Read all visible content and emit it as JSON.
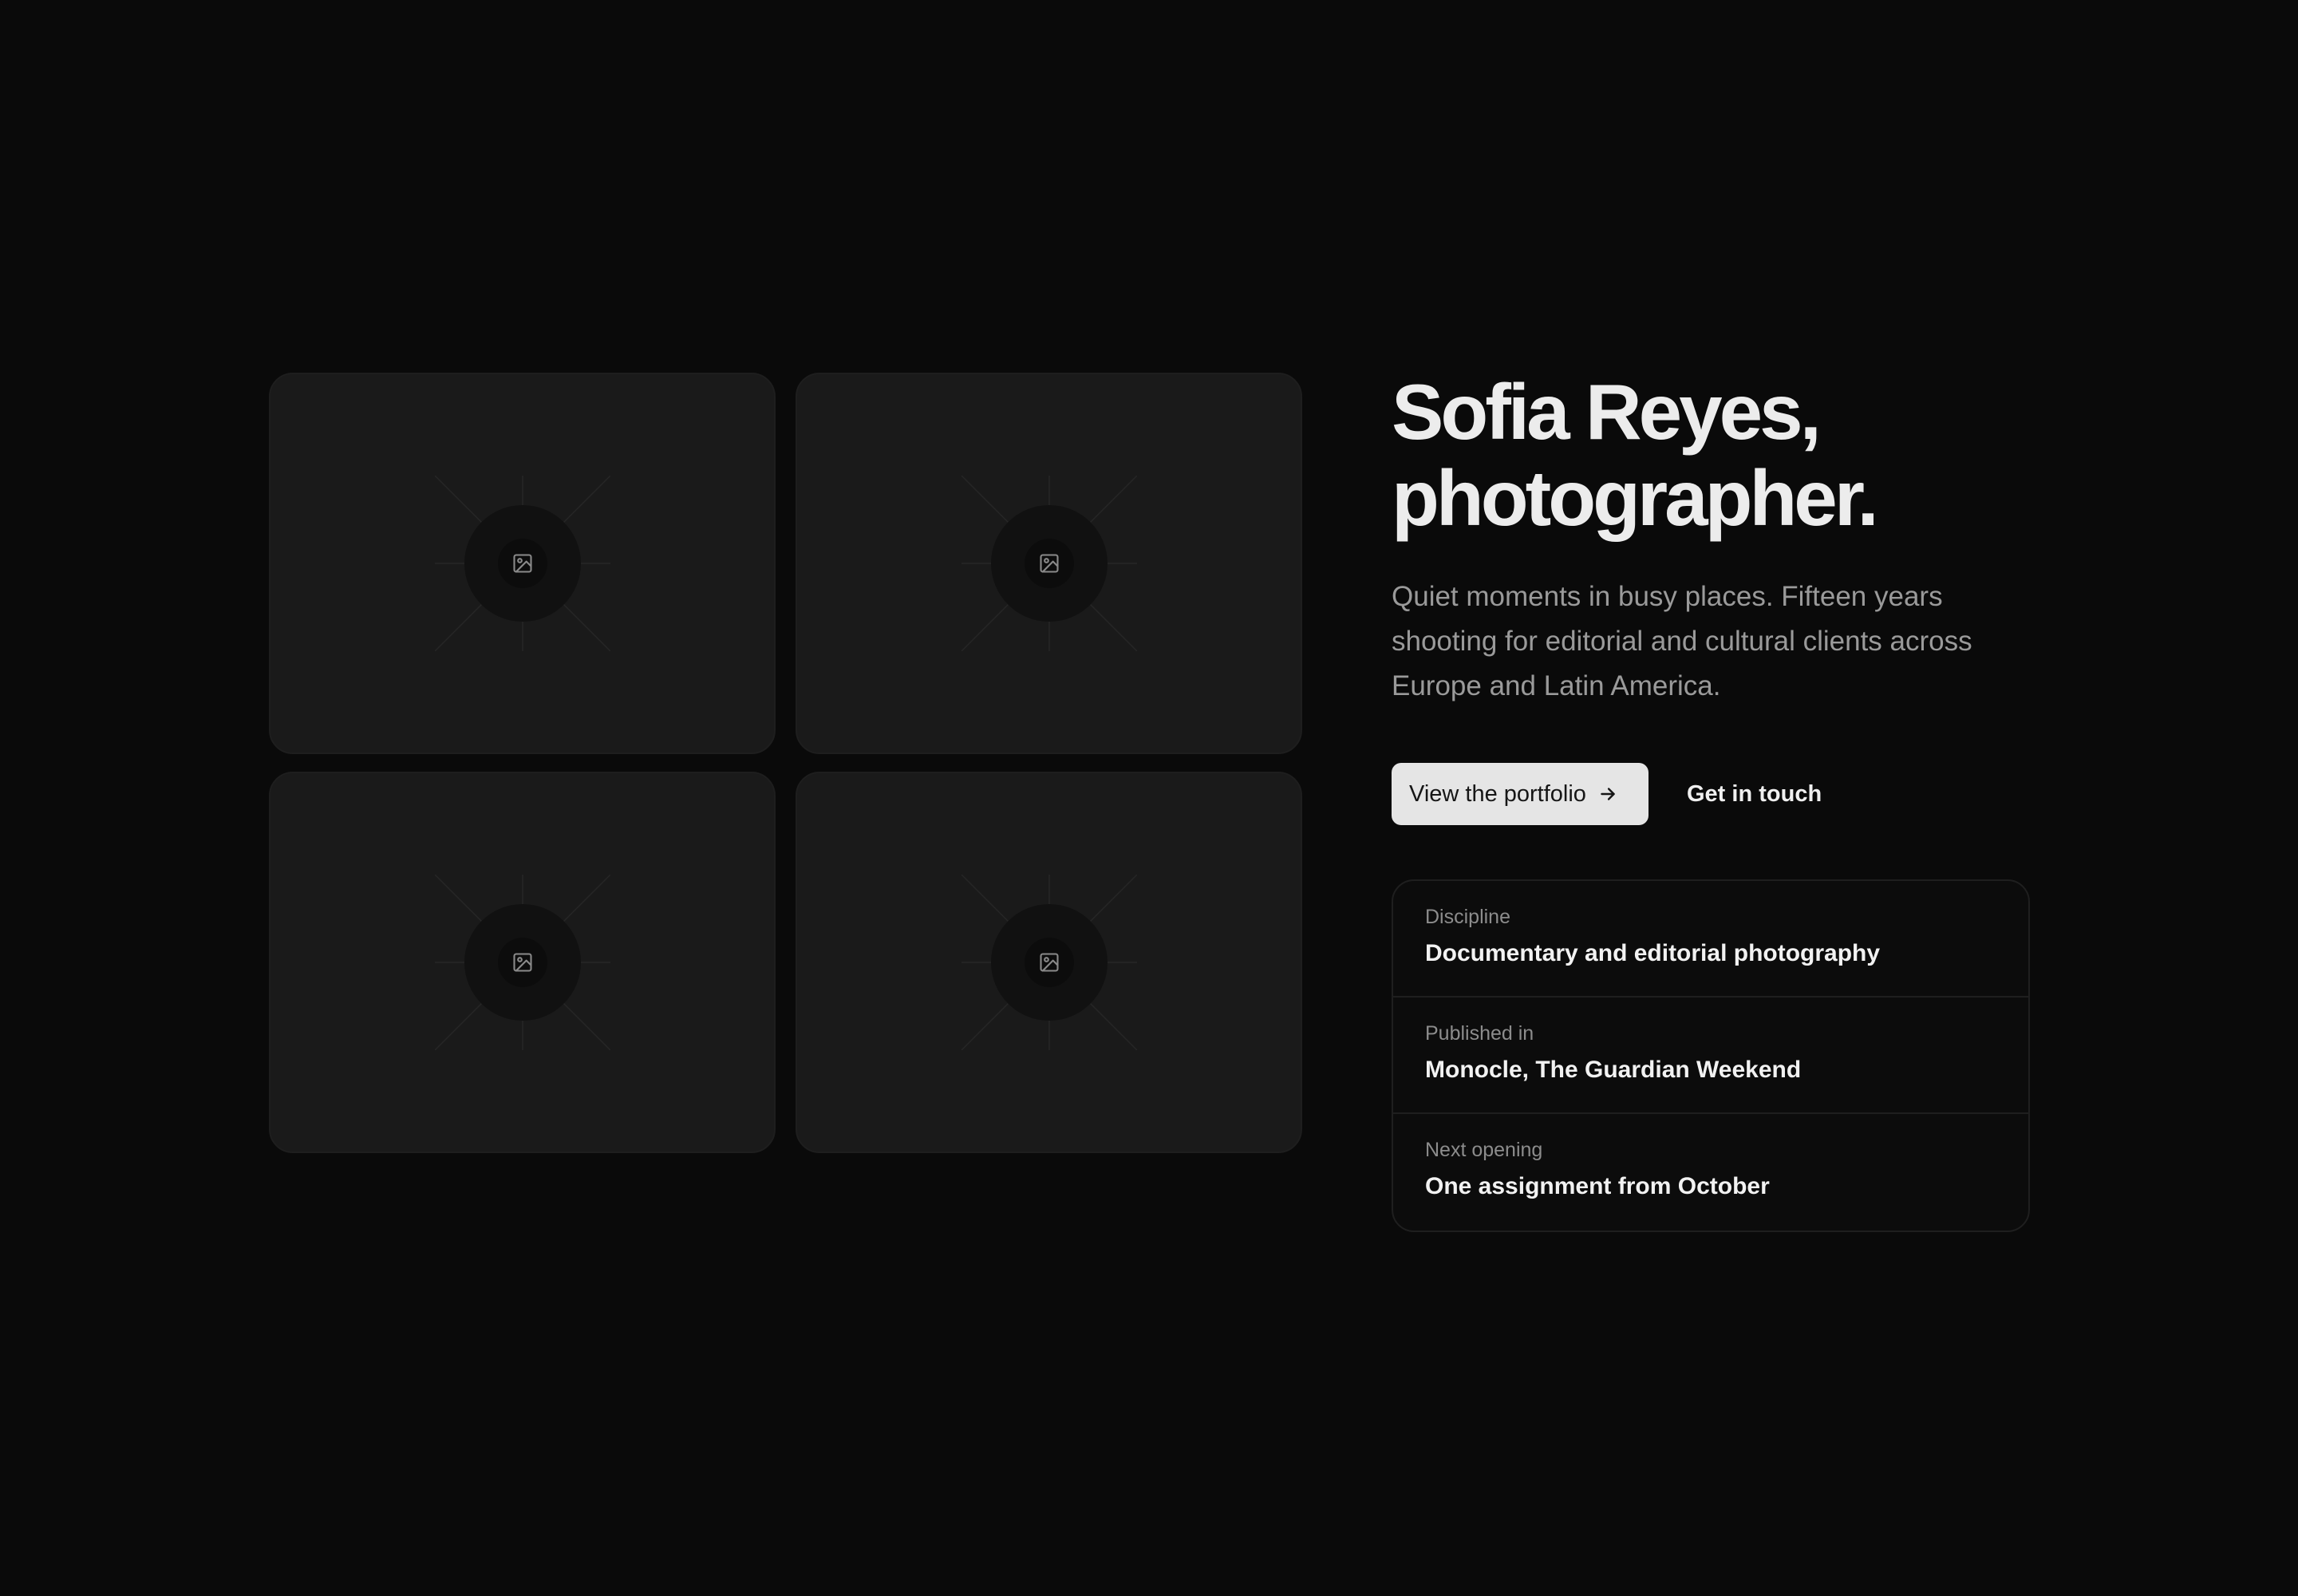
{
  "hero": {
    "title_line1": "Sofia Reyes,",
    "title_line2": "photographer.",
    "lede": "Quiet moments in busy places. Fifteen years shooting for editorial and cultural clients across Europe and Latin America."
  },
  "actions": {
    "primary_label": "View the portfolio",
    "secondary_label": "Get in touch"
  },
  "facts": [
    {
      "label": "Discipline",
      "value": "Documentary and editorial photography"
    },
    {
      "label": "Published in",
      "value": "Monocle, The Guardian Weekend"
    },
    {
      "label": "Next opening",
      "value": "One assignment from October"
    }
  ],
  "gallery": {
    "placeholder_icon": "image-icon"
  },
  "colors": {
    "background": "#0a0a0a",
    "tile": "#1a1a1a",
    "primary_button": "#e5e5e5",
    "text": "#ececec",
    "muted_text": "#9a9a9a"
  }
}
